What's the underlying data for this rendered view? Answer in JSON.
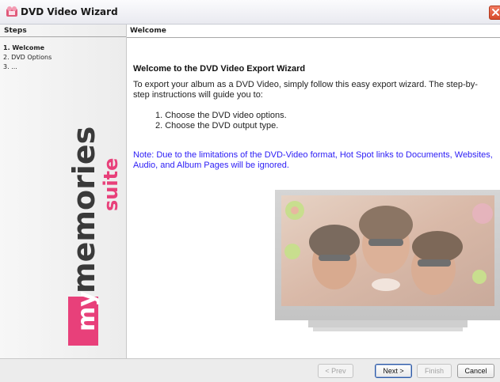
{
  "window": {
    "title": "DVD Video Wizard",
    "close_icon": "close-icon",
    "app_icon": "dvd-wizard-app-icon"
  },
  "steps_panel": {
    "header": "Steps",
    "items": [
      {
        "label": "1. Welcome",
        "active": true
      },
      {
        "label": "2. DVD Options",
        "active": false
      },
      {
        "label": "3. ...",
        "active": false
      }
    ]
  },
  "brand": {
    "prefix": "my",
    "main": "memories",
    "suffix": "suite",
    "colors": {
      "main": "#3a3a3a",
      "accent": "#e8407a",
      "box": "#e8407a"
    }
  },
  "content": {
    "header": "Welcome",
    "title": "Welcome to the DVD Video Export Wizard",
    "intro": "To export your album as a DVD Video, simply follow this easy export wizard. The step-by-step instructions will guide you to:",
    "steps": [
      "1. Choose the DVD video options.",
      "2. Choose the DVD output type."
    ],
    "note": "Note: Due to the limitations of the DVD-Video format, Hot Spot links to Documents, Websites, Audio, and Album Pages will be ignored.",
    "note_color": "#2b1cf5"
  },
  "buttons": {
    "prev": "< Prev",
    "next": "Next >",
    "finish": "Finish",
    "cancel": "Cancel"
  }
}
